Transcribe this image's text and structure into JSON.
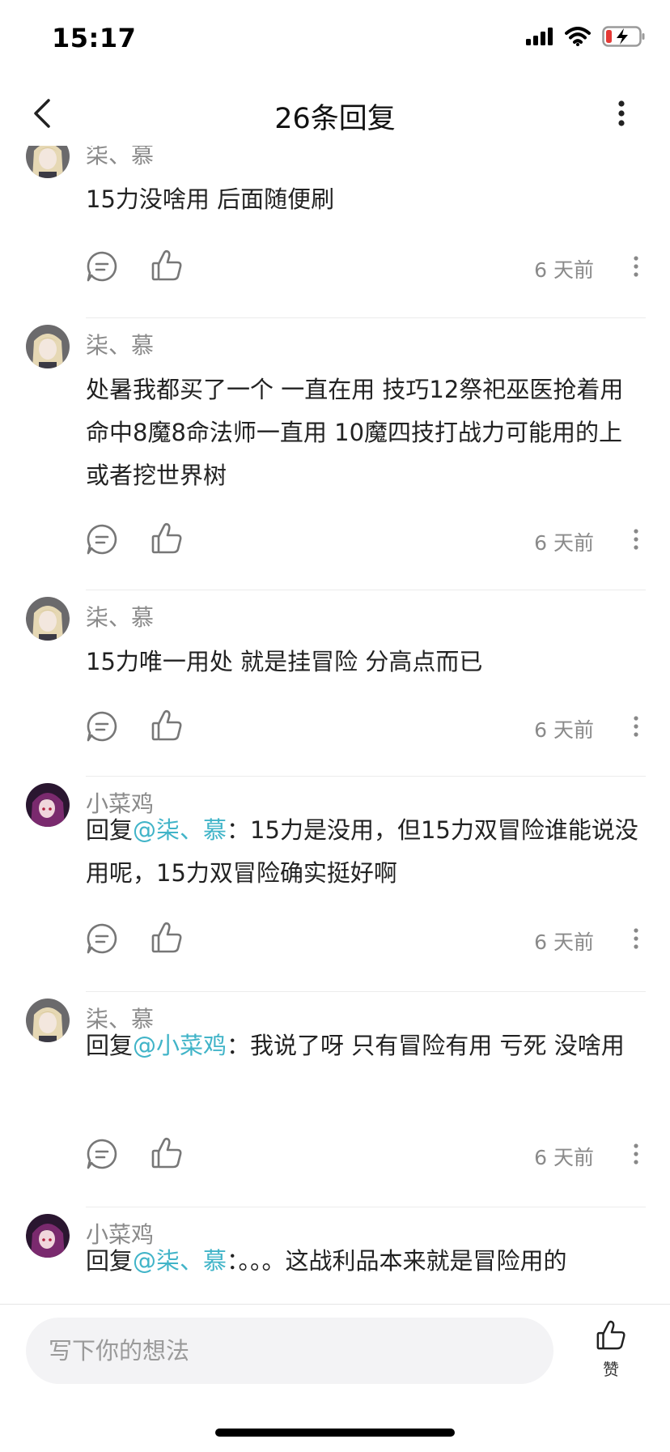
{
  "status": {
    "time": "15:17"
  },
  "nav": {
    "title": "26条回复"
  },
  "colors": {
    "mention": "#41b4c8",
    "secondary_text": "#8a8a8a",
    "battery_low": "#e53935"
  },
  "comments": [
    {
      "author": "柒、慕",
      "avatar": "anime-character-blonde",
      "reply_prefix": "",
      "reply_to": "",
      "colon": "",
      "text": "15力没啥用 后面随便刷",
      "time": "6 天前"
    },
    {
      "author": "柒、慕",
      "avatar": "anime-character-blonde",
      "reply_prefix": "",
      "reply_to": "",
      "colon": "",
      "text": "处暑我都买了一个  一直在用 技巧12祭祀巫医抢着用   命中8魔8命法师一直用 10魔四技打战力可能用的上或者挖世界树",
      "time": "6 天前"
    },
    {
      "author": "柒、慕",
      "avatar": "anime-character-blonde",
      "reply_prefix": "",
      "reply_to": "",
      "colon": "",
      "text": "15力唯一用处 就是挂冒险 分高点而已",
      "time": "6 天前"
    },
    {
      "author": "小菜鸡",
      "avatar": "anime-character-purple",
      "reply_prefix": "回复",
      "reply_to": "@柒、慕",
      "colon": "：",
      "text": "15力是没用，但15力双冒险谁能说没用呢，15力双冒险确实挺好啊",
      "time": "6 天前"
    },
    {
      "author": "柒、慕",
      "avatar": "anime-character-blonde",
      "reply_prefix": "回复",
      "reply_to": "@小菜鸡",
      "colon": "：",
      "text": "我说了呀 只有冒险有用 亏死 没啥用",
      "time": "6 天前"
    },
    {
      "author": "小菜鸡",
      "avatar": "anime-character-purple",
      "reply_prefix": "回复",
      "reply_to": "@柒、慕",
      "colon": "：",
      "text": "。。。这战利品本来就是冒险用的",
      "time": ""
    }
  ],
  "bottom": {
    "input_placeholder": "写下你的想法",
    "like_label": "赞"
  }
}
